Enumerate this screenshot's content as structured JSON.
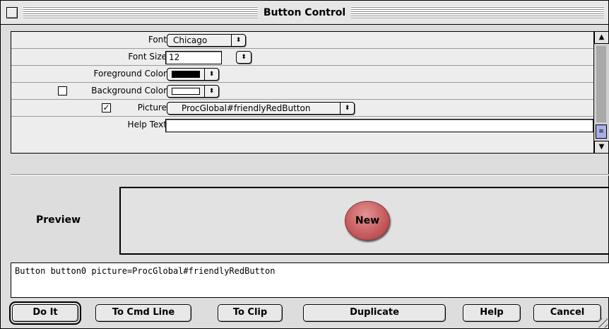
{
  "window": {
    "title": "Button Control"
  },
  "props": {
    "font": {
      "label": "Font",
      "value": "Chicago"
    },
    "font_size": {
      "label": "Font Size",
      "value": "12"
    },
    "foreground": {
      "label": "Foreground Color",
      "color": "#000000"
    },
    "background": {
      "label": "Background Color",
      "checked": false,
      "color": "#ffffff"
    },
    "picture": {
      "label": "Picture",
      "checked": true,
      "value": "ProcGlobal#friendlyRedButton"
    },
    "help": {
      "label": "Help Text",
      "value": ""
    }
  },
  "preview": {
    "label": "Preview",
    "button_label": "New",
    "button_color": "#c85e60"
  },
  "command_text": "Button button0 picture=ProcGlobal#friendlyRedButton",
  "buttons": {
    "do_it": "Do It",
    "to_cmd_line": "To Cmd Line",
    "to_clip": "To Clip",
    "duplicate": "Duplicate",
    "help": "Help",
    "cancel": "Cancel"
  },
  "icons": {
    "popup_arrow": "⬍",
    "check": "✓",
    "scroll_up": "▲",
    "scroll_down": "▼",
    "thumb": "≡"
  }
}
